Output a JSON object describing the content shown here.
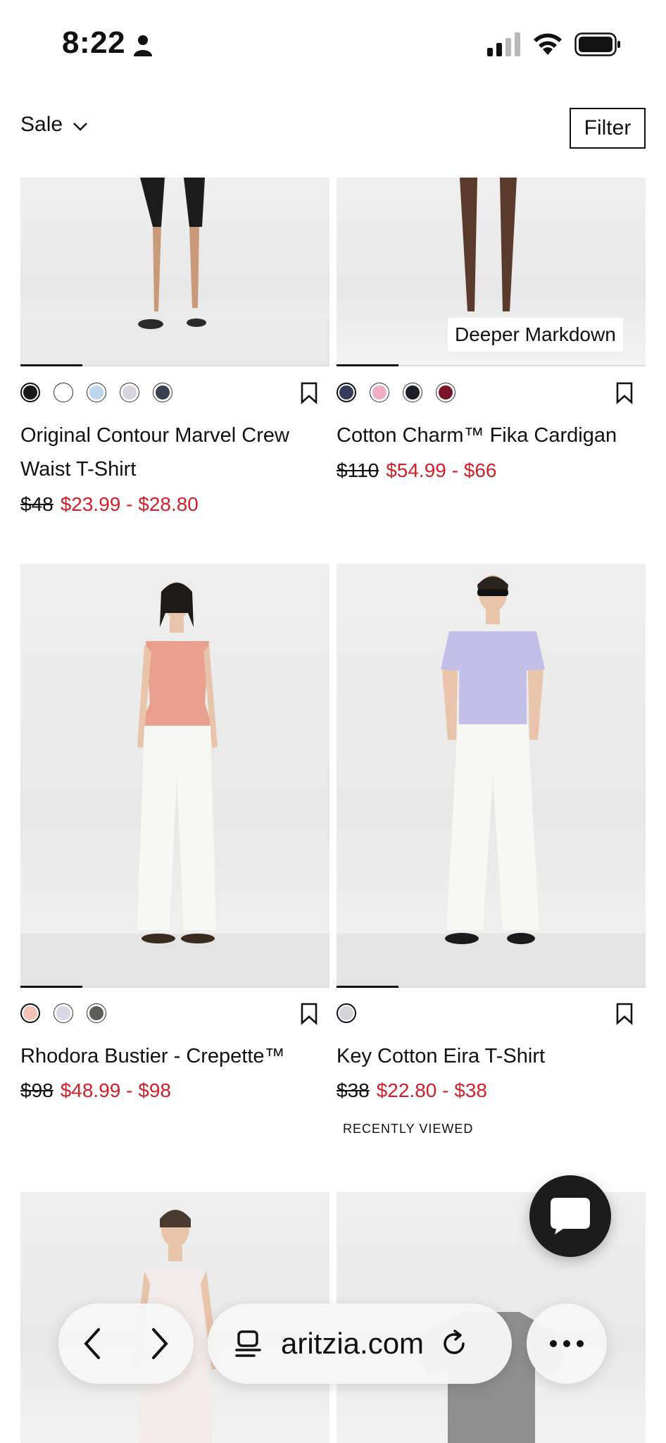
{
  "status_bar": {
    "time": "8:22"
  },
  "header": {
    "sort_label": "Sale",
    "filter_label": "Filter"
  },
  "products": [
    {
      "name": "Original Contour Marvel Crew Waist T-Shirt",
      "name_line1": "Original Contour Marvel Crew",
      "name_line2": "Waist T-Shirt",
      "old_price": "$48",
      "sale_price": "$23.99 - $28.80",
      "swatches": [
        "#1a1a1a",
        "#ffffff",
        "#bcd6ef",
        "#d8d3df",
        "#3b4150"
      ]
    },
    {
      "name": "Cotton Charm™ Fika Cardigan",
      "old_price": "$110",
      "sale_price": "$54.99 - $66",
      "badge": "Deeper Markdown",
      "swatches": [
        "#363b5a",
        "#f0aec3",
        "#1b1e27",
        "#7b1426"
      ]
    },
    {
      "name": "Rhodora Bustier - Crepette™",
      "old_price": "$98",
      "sale_price": "$48.99 - $98",
      "swatches": [
        "#f5c2b5",
        "#d9d8e6",
        "#5b5d59"
      ]
    },
    {
      "name": "Key Cotton Eira T-Shirt",
      "old_price": "$38",
      "sale_price": "$22.80 - $38",
      "tag": "RECENTLY VIEWED",
      "swatches": [
        "#d6d3da"
      ]
    }
  ],
  "browser": {
    "url": "aritzia.com"
  },
  "colors": {
    "sale_red": "#d0202a",
    "text": "#111111",
    "chat_button": "#1c1c1c"
  }
}
